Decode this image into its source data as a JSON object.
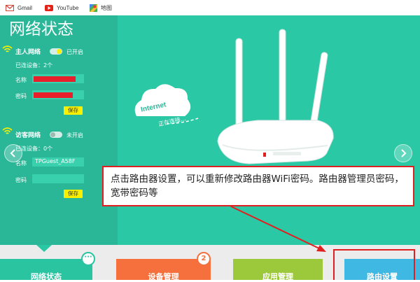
{
  "bookmarks": [
    {
      "label": "Gmail",
      "icon": "gmail-icon"
    },
    {
      "label": "YouTube",
      "icon": "youtube-icon"
    },
    {
      "label": "地图",
      "icon": "maps-icon"
    }
  ],
  "page_title": "网络状态",
  "main_network": {
    "title": "主人网络",
    "toggle_state": "已开启",
    "connected_label": "已连设备：2个",
    "name_label": "名称",
    "password_label": "密码",
    "save_label": "保存"
  },
  "guest_network": {
    "title": "访客网络",
    "toggle_state": "未开启",
    "connected_label": "已连设备：0个",
    "name_label": "名称",
    "name_value": "TPGuest_A58F",
    "password_label": "密码",
    "save_label": "保存"
  },
  "hero": {
    "cloud_text": "Internet",
    "status_text": "正在连接..."
  },
  "callout": {
    "text": "点击路由器设置，可以重新修改路由器WiFi密码。路由器管理员密码，宽带密码等"
  },
  "tabs": [
    {
      "label": "网络状态",
      "color": "#2bc4a1"
    },
    {
      "label": "设备管理",
      "color": "#f5703d",
      "badge": "2"
    },
    {
      "label": "应用管理",
      "color": "#9cc93b"
    },
    {
      "label": "路由设置",
      "color": "#3fb8e3"
    }
  ],
  "colors": {
    "teal": "#2ac7a4",
    "teal_dark": "#29b798",
    "accent_red": "#e02020",
    "yellow": "#f7f002"
  }
}
